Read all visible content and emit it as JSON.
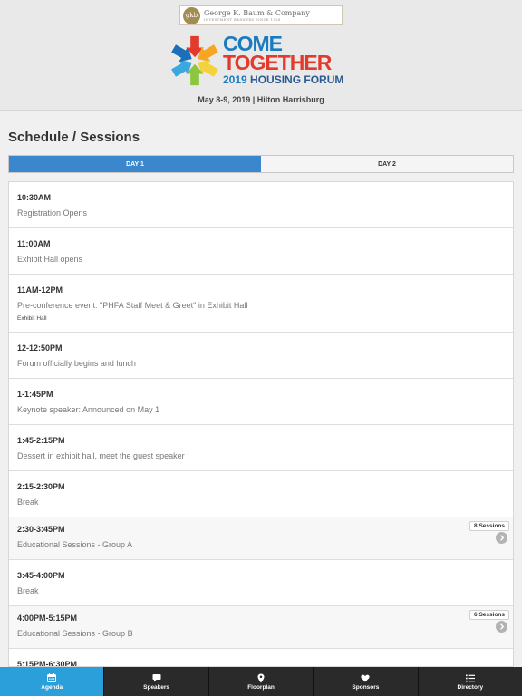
{
  "sponsor": {
    "seal_text": "gkb",
    "name": "George K. Baum & Company",
    "tagline": "INVESTMENT BANKERS SINCE 1928"
  },
  "event_logo": {
    "word1": "COME",
    "word2": "TOGETHER",
    "year": "2019",
    "forum": "HOUSING FORUM",
    "burst_colors": [
      "#e23b2e",
      "#f6a623",
      "#f4d23c",
      "#8cc63f",
      "#3aa8de",
      "#1b6fb8"
    ]
  },
  "event_date": "May 8-9, 2019 | Hilton Harrisburg",
  "page_title": "Schedule / Sessions",
  "day_tabs": [
    {
      "label": "DAY 1",
      "active": true
    },
    {
      "label": "DAY 2",
      "active": false
    }
  ],
  "sessions": [
    {
      "time": "10:30AM",
      "title": "Registration Opens",
      "location": "",
      "badge": "",
      "group": false
    },
    {
      "time": "11:00AM",
      "title": "Exhibit Hall opens",
      "location": "",
      "badge": "",
      "group": false
    },
    {
      "time": "11AM-12PM",
      "title": "Pre-conference event: \"PHFA Staff Meet & Greet\" in Exhibit Hall",
      "location": "Exhibit Hall",
      "badge": "",
      "group": false
    },
    {
      "time": "12-12:50PM",
      "title": "Forum officially begins and lunch",
      "location": "",
      "badge": "",
      "group": false
    },
    {
      "time": "1-1:45PM",
      "title": "Keynote speaker: Announced on May 1",
      "location": "",
      "badge": "",
      "group": false
    },
    {
      "time": "1:45-2:15PM",
      "title": "Dessert in exhibit hall, meet the guest speaker",
      "location": "",
      "badge": "",
      "group": false
    },
    {
      "time": "2:15-2:30PM",
      "title": "Break",
      "location": "",
      "badge": "",
      "group": false
    },
    {
      "time": "2:30-3:45PM",
      "title": "Educational Sessions - Group A",
      "location": "",
      "badge": "8 Sessions",
      "group": true
    },
    {
      "time": "3:45-4:00PM",
      "title": "Break",
      "location": "",
      "badge": "",
      "group": false
    },
    {
      "time": "4:00PM-5:15PM",
      "title": "Educational Sessions - Group B",
      "location": "",
      "badge": "6 Sessions",
      "group": true
    },
    {
      "time": "5:15PM-6:30PM",
      "title": "",
      "location": "",
      "badge": "",
      "group": false
    }
  ],
  "tabbar": [
    {
      "label": "Agenda",
      "icon": "calendar-icon",
      "active": true
    },
    {
      "label": "Speakers",
      "icon": "speech-bubble-icon",
      "active": false
    },
    {
      "label": "Floorplan",
      "icon": "map-pin-icon",
      "active": false
    },
    {
      "label": "Sponsors",
      "icon": "heart-icon",
      "active": false
    },
    {
      "label": "Directory",
      "icon": "list-icon",
      "active": false
    }
  ],
  "colors": {
    "accent": "#3a87cd",
    "tabbar_active": "#2b9fd9",
    "tabbar_bg": "#2a2a2a"
  }
}
